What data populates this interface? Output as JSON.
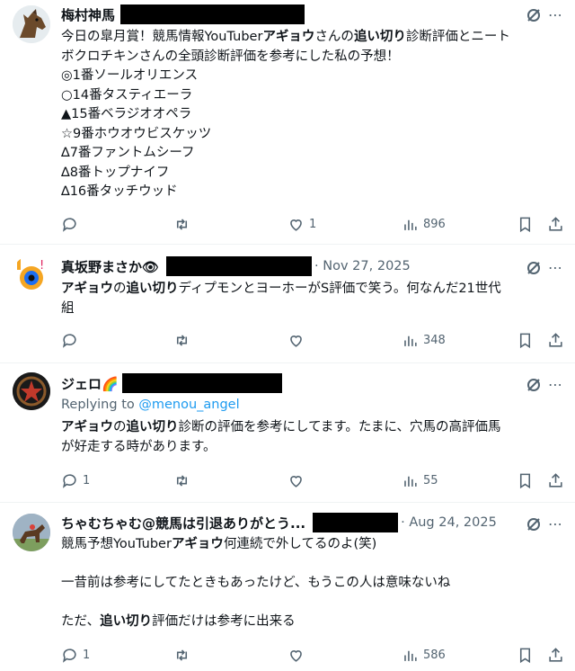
{
  "tweets": [
    {
      "name": "梅村神馬",
      "meta": "",
      "reply_to_label": "",
      "reply_to_handle": "",
      "lines": [
        [
          {
            "t": "今日の皐月賞！競馬情報YouTuber"
          },
          {
            "t": "アギョウ",
            "b": true
          },
          {
            "t": "さんの"
          },
          {
            "t": "追い切り",
            "b": true
          },
          {
            "t": "診断評価とニート"
          }
        ],
        [
          {
            "t": "ボクロチキンさんの全頭診断評価を参考にした私の予想！"
          }
        ],
        [
          {
            "t": "◎1番ソールオリエンス"
          }
        ],
        [
          {
            "t": "○14番タスティエーラ"
          }
        ],
        [
          {
            "t": "▲15番ベラジオオペラ"
          }
        ],
        [
          {
            "t": "☆9番ホウオウビスケッツ"
          }
        ],
        [
          {
            "t": "∆7番ファントムシーフ"
          }
        ],
        [
          {
            "t": "∆8番トップナイフ"
          }
        ],
        [
          {
            "t": "∆16番タッチウッド"
          }
        ]
      ],
      "stats": {
        "replies": "",
        "retweets": "",
        "likes": "1",
        "views": "896"
      }
    },
    {
      "name": "真坂野まさか👁",
      "meta": "· Nov 27, 2025",
      "reply_to_label": "",
      "reply_to_handle": "",
      "lines": [
        [
          {
            "t": "アギョウ",
            "b": true
          },
          {
            "t": "の"
          },
          {
            "t": "追い切り",
            "b": true
          },
          {
            "t": "ディプモンとヨーホーがS評価で笑う。何なんだ21世代"
          }
        ],
        [
          {
            "t": "組"
          }
        ]
      ],
      "stats": {
        "replies": "",
        "retweets": "",
        "likes": "",
        "views": "348"
      }
    },
    {
      "name": "ジェロ🌈",
      "meta": "",
      "reply_to_label": "Replying to",
      "reply_to_handle": "@menou_angel",
      "lines": [
        [
          {
            "t": "アギョウ",
            "b": true
          },
          {
            "t": "の"
          },
          {
            "t": "追い切り",
            "b": true
          },
          {
            "t": "診断の評価を参考にしてます。たまに、穴馬の高評価馬"
          }
        ],
        [
          {
            "t": "が好走する時があります。"
          }
        ]
      ],
      "stats": {
        "replies": "1",
        "retweets": "",
        "likes": "",
        "views": "55"
      }
    },
    {
      "name": "ちゃむちゃむ@競馬は引退ありがとう...",
      "meta": "· Aug 24, 2025",
      "reply_to_label": "",
      "reply_to_handle": "",
      "lines": [
        [
          {
            "t": "競馬予想YouTuber"
          },
          {
            "t": "アギョウ",
            "b": true
          },
          {
            "t": "何連続で外してるのよ(笑)"
          }
        ],
        [
          {
            "t": ""
          }
        ],
        [
          {
            "t": "一昔前は参考にしてたときもあったけど、もうこの人は意味ないね"
          }
        ],
        [
          {
            "t": ""
          }
        ],
        [
          {
            "t": "ただ、"
          },
          {
            "t": "追い切り",
            "b": true
          },
          {
            "t": "評価だけは参考に出来る"
          }
        ]
      ],
      "stats": {
        "replies": "1",
        "retweets": "",
        "likes": "",
        "views": "586"
      }
    }
  ]
}
